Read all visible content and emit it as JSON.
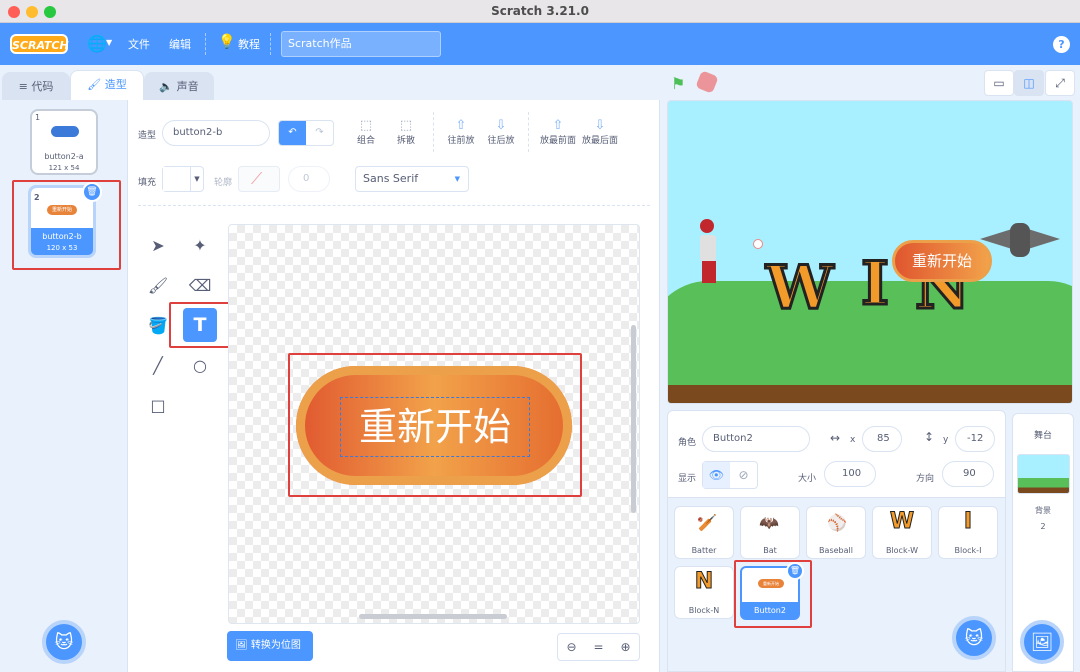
{
  "window": {
    "title": "Scratch 3.21.0"
  },
  "menu": {
    "logo": "SCRATCH",
    "file": "文件",
    "edit": "编辑",
    "tutorials": "教程",
    "project_title": "Scratch作品",
    "help": "?"
  },
  "tabs": {
    "code": "代码",
    "costumes": "造型",
    "sounds": "声音"
  },
  "costumes": [
    {
      "num": "1",
      "name": "button2-a",
      "size": "121 x 54"
    },
    {
      "num": "2",
      "name": "button2-b",
      "size": "120 x 53",
      "thumb_text": "重新开始"
    }
  ],
  "editor": {
    "costume_label": "造型",
    "costume_name": "button2-b",
    "group": "组合",
    "ungroup": "拆散",
    "forward": "往前放",
    "backward": "往后放",
    "front": "放最前面",
    "back": "放最后面",
    "fill_label": "填充",
    "outline_label": "轮廓",
    "outline_value": "0",
    "font": "Sans Serif",
    "canvas_text": "重新开始",
    "convert_bitmap": "转换为位图",
    "zoom_reset": "="
  },
  "stage": {
    "win_letters": [
      "W",
      "I",
      "N"
    ],
    "button_text": "重新开始"
  },
  "sprite_info": {
    "sprite_label": "角色",
    "sprite_name": "Button2",
    "x_label": "x",
    "x_value": "85",
    "y_label": "y",
    "y_value": "-12",
    "show_label": "显示",
    "size_label": "大小",
    "size_value": "100",
    "direction_label": "方向",
    "direction_value": "90"
  },
  "sprites": [
    {
      "name": "Batter",
      "icon": "batter-icon"
    },
    {
      "name": "Bat",
      "icon": "bat-icon"
    },
    {
      "name": "Baseball",
      "icon": "baseball-icon"
    },
    {
      "name": "Block-W",
      "letter": "W"
    },
    {
      "name": "Block-I",
      "letter": "I"
    },
    {
      "name": "Block-N",
      "letter": "N"
    },
    {
      "name": "Button2",
      "thumb_text": "重新开始",
      "selected": true
    }
  ],
  "stage_pane": {
    "title": "舞台",
    "backdrop_label": "背景",
    "backdrop_count": "2"
  },
  "colors": {
    "accent": "#4c97ff",
    "highlight": "#e0403d",
    "button_orange": "#e8833a"
  }
}
